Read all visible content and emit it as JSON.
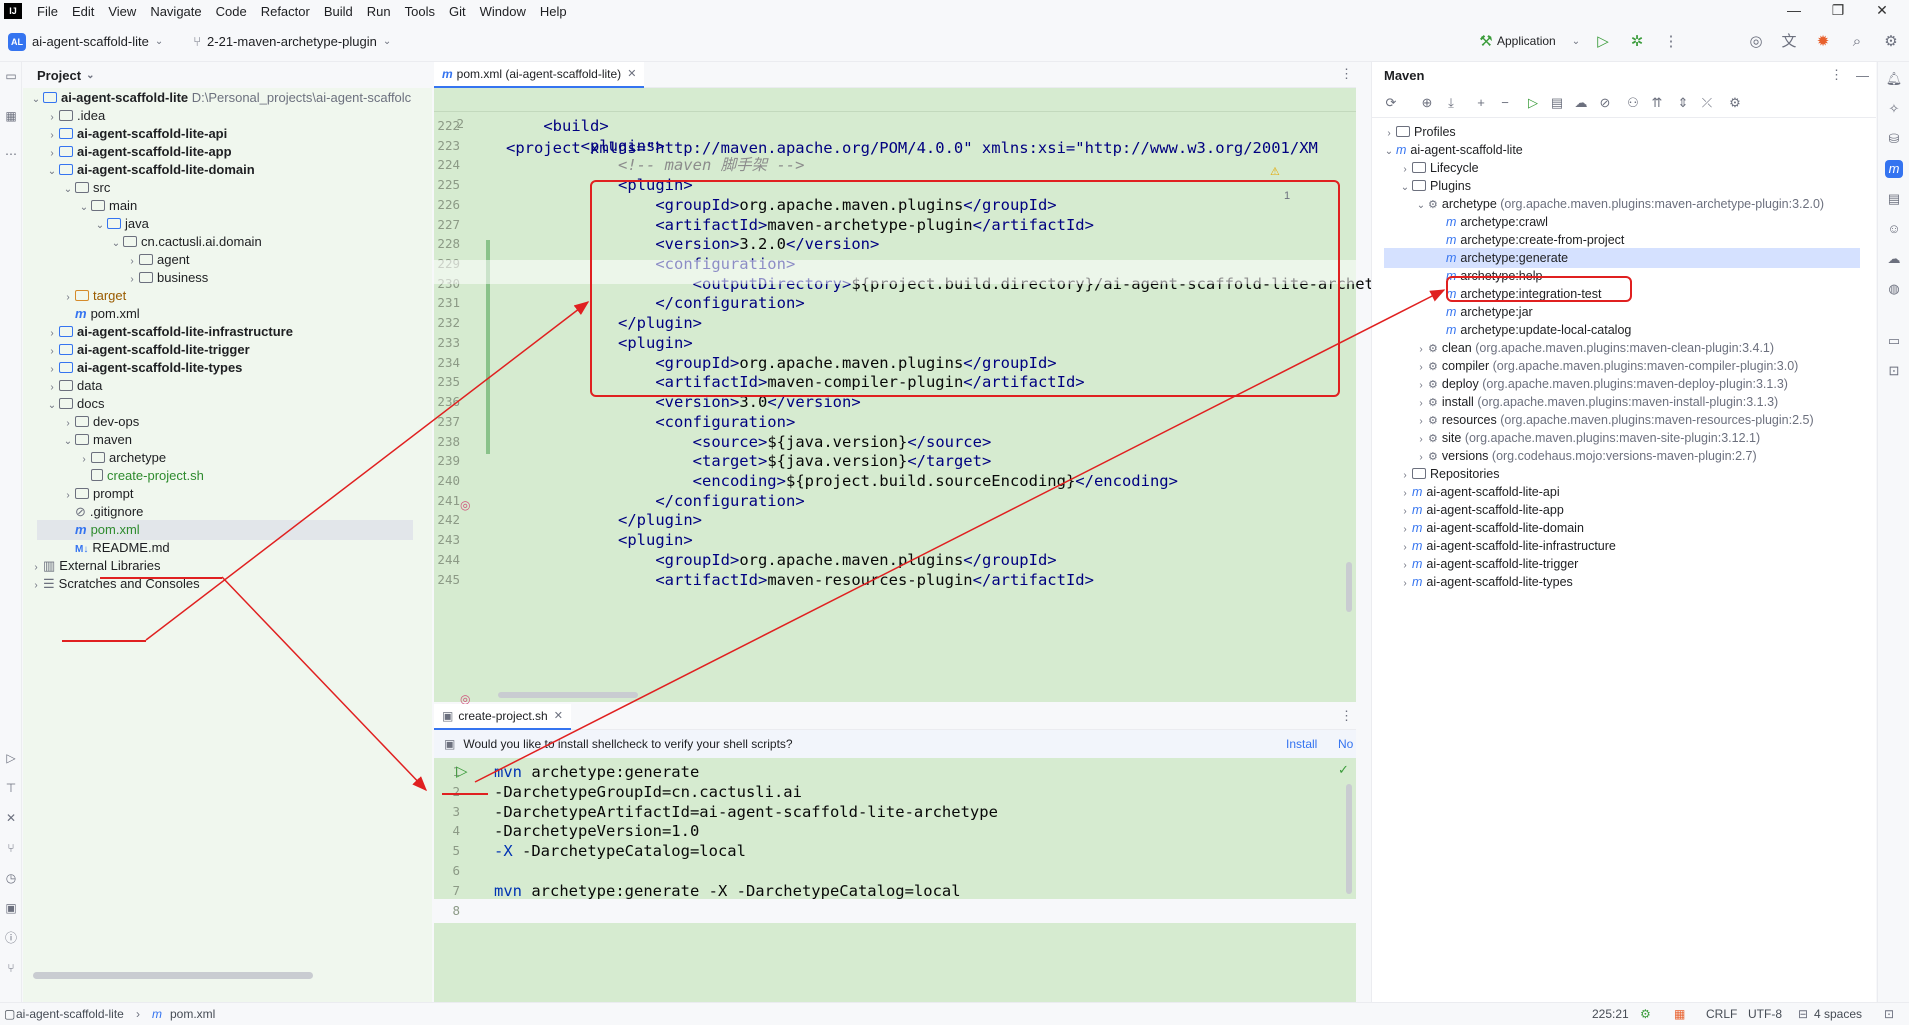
{
  "menubar": {
    "logo": "IJ",
    "items": [
      "File",
      "Edit",
      "View",
      "Navigate",
      "Code",
      "Refactor",
      "Build",
      "Run",
      "Tools",
      "Git",
      "Window",
      "Help"
    ],
    "window_controls": [
      "—",
      "❐",
      "✕"
    ]
  },
  "toolbar": {
    "project_badge": "AL",
    "project_name": "ai-agent-scaffold-lite",
    "branch": "2-21-maven-archetype-plugin",
    "run_config": "Application"
  },
  "project_panel": {
    "title": "Project",
    "root_name": "ai-agent-scaffold-lite",
    "root_path": "D:\\Personal_projects\\ai-agent-scaffolc",
    "items": [
      {
        "label": ".idea"
      },
      {
        "label": "ai-agent-scaffold-lite-api"
      },
      {
        "label": "ai-agent-scaffold-lite-app"
      },
      {
        "label": "ai-agent-scaffold-lite-domain"
      },
      {
        "label": "src"
      },
      {
        "label": "main"
      },
      {
        "label": "java"
      },
      {
        "label": "cn.cactusli.ai.domain"
      },
      {
        "label": "agent"
      },
      {
        "label": "business"
      },
      {
        "label": "target"
      },
      {
        "label": "pom.xml"
      },
      {
        "label": "ai-agent-scaffold-lite-infrastructure"
      },
      {
        "label": "ai-agent-scaffold-lite-trigger"
      },
      {
        "label": "ai-agent-scaffold-lite-types"
      },
      {
        "label": "data"
      },
      {
        "label": "docs"
      },
      {
        "label": "dev-ops"
      },
      {
        "label": "maven"
      },
      {
        "label": "archetype"
      },
      {
        "label": "create-project.sh"
      },
      {
        "label": "prompt"
      },
      {
        "label": ".gitignore"
      },
      {
        "label": "pom.xml"
      },
      {
        "label": "README.md"
      },
      {
        "label": "External Libraries"
      },
      {
        "label": "Scratches and Consoles"
      }
    ]
  },
  "editor": {
    "tab_label": "pom.xml (ai-agent-scaffold-lite)",
    "sticky_line_number": "2",
    "sticky_code": "<project xmlns=\"http://maven.apache.org/POM/4.0.0\" xmlns:xsi=\"http://www.w3.org/2001/XM",
    "warning_count": "1",
    "lines": [
      {
        "n": "222",
        "code": "    <build>"
      },
      {
        "n": "223",
        "code": "        <plugins>"
      },
      {
        "n": "224",
        "code": "            <!-- maven 脚手架 -->"
      },
      {
        "n": "225",
        "code": "            <plugin>"
      },
      {
        "n": "226",
        "code": "                <groupId>org.apache.maven.plugins</groupId>"
      },
      {
        "n": "227",
        "code": "                <artifactId>maven-archetype-plugin</artifactId>"
      },
      {
        "n": "228",
        "code": "                <version>3.2.0</version>"
      },
      {
        "n": "229",
        "code": "                <configuration>"
      },
      {
        "n": "230",
        "code": "                    <outputDirectory>${project.build.directory}/ai-agent-scaffold-lite-archetype"
      },
      {
        "n": "231",
        "code": "                </configuration>"
      },
      {
        "n": "232",
        "code": "            </plugin>"
      },
      {
        "n": "233",
        "code": "            <plugin>"
      },
      {
        "n": "234",
        "code": "                <groupId>org.apache.maven.plugins</groupId>"
      },
      {
        "n": "235",
        "code": "                <artifactId>maven-compiler-plugin</artifactId>"
      },
      {
        "n": "236",
        "code": "                <version>3.0</version>"
      },
      {
        "n": "237",
        "code": "                <configuration>"
      },
      {
        "n": "238",
        "code": "                    <source>${java.version}</source>"
      },
      {
        "n": "239",
        "code": "                    <target>${java.version}</target>"
      },
      {
        "n": "240",
        "code": "                    <encoding>${project.build.sourceEncoding}</encoding>"
      },
      {
        "n": "241",
        "code": "                </configuration>"
      },
      {
        "n": "242",
        "code": "            </plugin>"
      },
      {
        "n": "243",
        "code": "            <plugin>"
      },
      {
        "n": "244",
        "code": "                <groupId>org.apache.maven.plugins</groupId>"
      },
      {
        "n": "245",
        "code": "                <artifactId>maven-resources-plugin</artifactId>"
      }
    ]
  },
  "shell_editor": {
    "tab_label": "create-project.sh",
    "notice": "Would you like to install shellcheck to verify your shell scripts?",
    "install_link": "Install",
    "no_link": "No",
    "lines": [
      {
        "n": "1",
        "code": "mvn archetype:generate"
      },
      {
        "n": "2",
        "code": "-DarchetypeGroupId=cn.cactusli.ai"
      },
      {
        "n": "3",
        "code": "-DarchetypeArtifactId=ai-agent-scaffold-lite-archetype"
      },
      {
        "n": "4",
        "code": "-DarchetypeVersion=1.0"
      },
      {
        "n": "5",
        "code": "-X -DarchetypeCatalog=local"
      },
      {
        "n": "6",
        "code": ""
      },
      {
        "n": "7",
        "code": "mvn archetype:generate -X -DarchetypeCatalog=local"
      },
      {
        "n": "8",
        "code": ""
      }
    ]
  },
  "maven_panel": {
    "title": "Maven",
    "items": [
      {
        "label": "Profiles"
      },
      {
        "label": "ai-agent-scaffold-lite"
      },
      {
        "label": "Lifecycle"
      },
      {
        "label": "Plugins"
      },
      {
        "label": "archetype",
        "detail": "(org.apache.maven.plugins:maven-archetype-plugin:3.2.0)"
      },
      {
        "label": "archetype:crawl"
      },
      {
        "label": "archetype:create-from-project"
      },
      {
        "label": "archetype:generate"
      },
      {
        "label": "archetype:help"
      },
      {
        "label": "archetype:integration-test"
      },
      {
        "label": "archetype:jar"
      },
      {
        "label": "archetype:update-local-catalog"
      },
      {
        "label": "clean",
        "detail": "(org.apache.maven.plugins:maven-clean-plugin:3.4.1)"
      },
      {
        "label": "compiler",
        "detail": "(org.apache.maven.plugins:maven-compiler-plugin:3.0)"
      },
      {
        "label": "deploy",
        "detail": "(org.apache.maven.plugins:maven-deploy-plugin:3.1.3)"
      },
      {
        "label": "install",
        "detail": "(org.apache.maven.plugins:maven-install-plugin:3.1.3)"
      },
      {
        "label": "resources",
        "detail": "(org.apache.maven.plugins:maven-resources-plugin:2.5)"
      },
      {
        "label": "site",
        "detail": "(org.apache.maven.plugins:maven-site-plugin:3.12.1)"
      },
      {
        "label": "versions",
        "detail": "(org.codehaus.mojo:versions-maven-plugin:2.7)"
      },
      {
        "label": "Repositories"
      },
      {
        "label": "ai-agent-scaffold-lite-api"
      },
      {
        "label": "ai-agent-scaffold-lite-app"
      },
      {
        "label": "ai-agent-scaffold-lite-domain"
      },
      {
        "label": "ai-agent-scaffold-lite-infrastructure"
      },
      {
        "label": "ai-agent-scaffold-lite-trigger"
      },
      {
        "label": "ai-agent-scaffold-lite-types"
      }
    ]
  },
  "statusbar": {
    "breadcrumb_root": "ai-agent-scaffold-lite",
    "breadcrumb_file": "pom.xml",
    "caret": "225:21",
    "line_sep": "CRLF",
    "encoding": "UTF-8",
    "indent": "4 spaces"
  },
  "colors": {
    "accent": "#3574f0",
    "annotation_red": "#e02020",
    "editor_bg": "#d6ebd0",
    "selection": "#d5e1ff"
  }
}
